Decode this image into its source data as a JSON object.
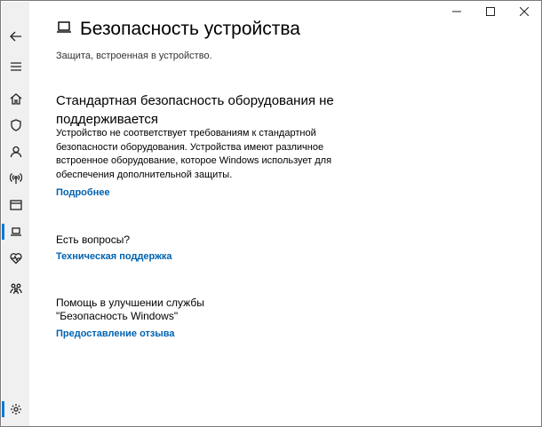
{
  "window": {
    "caption": {
      "minimize_icon": "minimize-icon",
      "maximize_icon": "maximize-icon",
      "close_icon": "close-icon"
    }
  },
  "sidebar": {
    "items": [
      {
        "name": "back",
        "icon": "back-arrow-icon"
      },
      {
        "name": "menu",
        "icon": "hamburger-icon"
      },
      {
        "name": "home",
        "icon": "home-icon"
      },
      {
        "name": "virus-protection",
        "icon": "shield-icon"
      },
      {
        "name": "account-protection",
        "icon": "person-icon"
      },
      {
        "name": "firewall-network",
        "icon": "antenna-icon"
      },
      {
        "name": "app-browser-control",
        "icon": "app-window-icon"
      },
      {
        "name": "device-security",
        "icon": "laptop-icon",
        "active": true
      },
      {
        "name": "device-performance",
        "icon": "heart-pulse-icon"
      },
      {
        "name": "family-options",
        "icon": "family-icon"
      },
      {
        "name": "settings",
        "icon": "gear-icon"
      }
    ],
    "accent_color": "#0078d7"
  },
  "header": {
    "title": "Безопасность устройства",
    "subtitle": "Защита, встроенная в устройство.",
    "icon": "laptop-icon"
  },
  "hardware_security": {
    "heading": "Стандартная безопасность оборудования не поддерживается",
    "description": "Устройство не соответствует требованиям к стандартной безопасности оборудования. Устройства имеют различное встроенное оборудование, которое Windows использует для обеспечения дополнительной защиты.",
    "link": "Подробнее"
  },
  "questions": {
    "heading": "Есть вопросы?",
    "link": "Техническая поддержка"
  },
  "feedback": {
    "heading_line1": "Помощь в улучшении службы",
    "heading_line2": "\"Безопасность Windows\"",
    "link": "Предоставление отзыва"
  },
  "link_color": "#0063b1"
}
